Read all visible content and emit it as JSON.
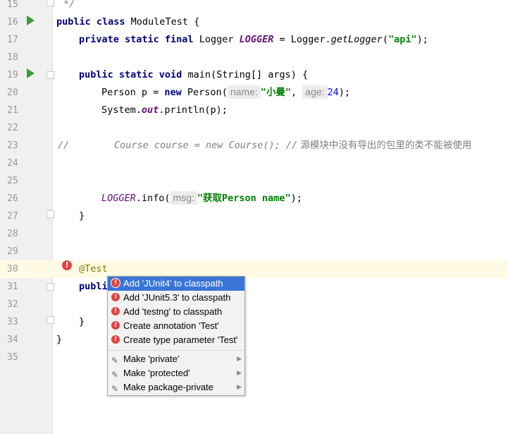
{
  "editor": {
    "lines": [
      {
        "num": "15"
      },
      {
        "num": "16"
      },
      {
        "num": "17"
      },
      {
        "num": "18"
      },
      {
        "num": "19"
      },
      {
        "num": "20"
      },
      {
        "num": "21"
      },
      {
        "num": "22"
      },
      {
        "num": "23"
      },
      {
        "num": "24"
      },
      {
        "num": "25"
      },
      {
        "num": "26"
      },
      {
        "num": "27"
      },
      {
        "num": "28"
      },
      {
        "num": "29"
      },
      {
        "num": "30"
      },
      {
        "num": "31"
      },
      {
        "num": "32"
      },
      {
        "num": "33"
      },
      {
        "num": "34"
      },
      {
        "num": "35"
      }
    ],
    "code": {
      "l15": "*/",
      "l16_kw": "public class ",
      "l16_rest": "ModuleTest {",
      "l17_kw": "private static final ",
      "l17_type": "Logger ",
      "l17_field": "LOGGER",
      "l17_eq": " = Logger.",
      "l17_method": "getLogger",
      "l17_open": "(",
      "l17_str": "\"api\"",
      "l17_close": ");",
      "l19_kw": "public static void ",
      "l19_rest": "main(String[] args) {",
      "l20_a": "Person p = ",
      "l20_new": "new ",
      "l20_b": "Person(",
      "l20_hint1": "name:",
      "l20_str": "\"小曼\"",
      "l20_comma": ", ",
      "l20_hint2": "age:",
      "l20_num": "24",
      "l20_end": ");",
      "l21_a": "System.",
      "l21_out": "out",
      "l21_b": ".println(p);",
      "l23_slashes": "//",
      "l23_code": "Course course = new Course(); //",
      "l23_text": " 源模块中没有导出的包里的类不能被使用",
      "l26_field": "LOGGER",
      "l26_b": ".info(",
      "l26_hint": "msg:",
      "l26_str": "\"获取Person name\"",
      "l26_end": ");",
      "l27": "}",
      "l30": "@Test",
      "l31_kw": "publi",
      "l33": "}",
      "l34": "}"
    }
  },
  "popup": {
    "items": [
      {
        "label": "Add 'JUnit4' to classpath",
        "icon": "error-icon"
      },
      {
        "label": "Add 'JUnit5.3' to classpath",
        "icon": "error-icon"
      },
      {
        "label": "Add 'testng' to classpath",
        "icon": "error-icon"
      },
      {
        "label": "Create annotation 'Test'",
        "icon": "error-icon"
      },
      {
        "label": "Create type parameter 'Test'",
        "icon": "error-icon"
      },
      {
        "label": "Make 'private'",
        "icon": "fix-icon"
      },
      {
        "label": "Make 'protected'",
        "icon": "fix-icon"
      },
      {
        "label": "Make package-private",
        "icon": "fix-icon"
      }
    ]
  },
  "colors": {
    "selection": "#3875d7",
    "keyword": "#000080",
    "string": "#008000",
    "current_line": "#fffae3"
  }
}
